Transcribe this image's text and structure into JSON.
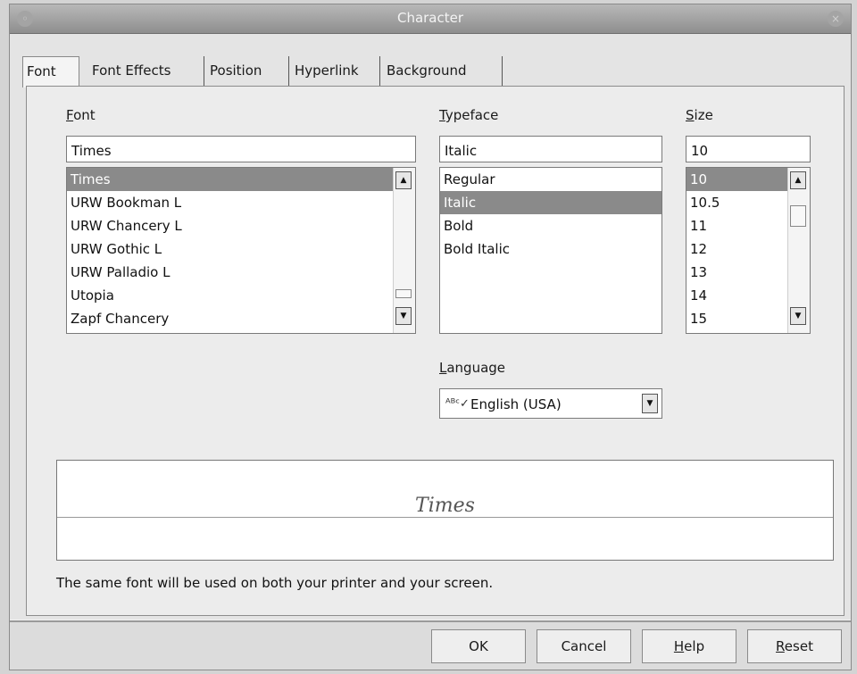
{
  "window": {
    "title": "Character",
    "close_glyph": "×",
    "menu_glyph": "◦"
  },
  "tabs": [
    "Font",
    "Font Effects",
    "Position",
    "Hyperlink",
    "Background"
  ],
  "font": {
    "label_accel": "F",
    "label_rest": "ont",
    "value": "Times",
    "items": [
      "Times",
      "URW Bookman L",
      "URW Chancery L",
      "URW Gothic L",
      "URW Palladio L",
      "Utopia",
      "Zapf Chancery"
    ],
    "selected_index": 0
  },
  "typeface": {
    "label_accel": "T",
    "label_rest": "ypeface",
    "value": "Italic",
    "items": [
      "Regular",
      "Italic",
      "Bold",
      "Bold Italic"
    ],
    "selected_index": 1
  },
  "size": {
    "label_accel": "S",
    "label_rest": "ize",
    "value": "10",
    "items": [
      "10",
      "10.5",
      "11",
      "12",
      "13",
      "14",
      "15"
    ],
    "selected_index": 0
  },
  "language": {
    "label_accel": "L",
    "label_rest": "anguage",
    "value": "English (USA)",
    "spell_icon_glyph": "ᴬᴮᶜ✓"
  },
  "preview": {
    "text": "Times"
  },
  "note": "The same font will be used on both your printer and your screen.",
  "buttons": {
    "ok": "OK",
    "cancel": "Cancel",
    "help_accel": "H",
    "help_rest": "elp",
    "reset_accel": "R",
    "reset_rest": "eset"
  },
  "glyphs": {
    "up": "▲",
    "down": "▼"
  }
}
